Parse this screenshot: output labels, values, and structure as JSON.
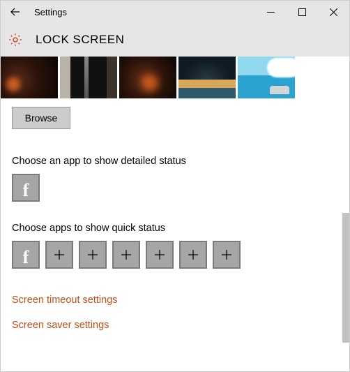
{
  "window": {
    "title": "Settings"
  },
  "page": {
    "title": "LOCK SCREEN"
  },
  "browse": {
    "label": "Browse"
  },
  "sections": {
    "detailed": "Choose an app to show detailed status",
    "quick": "Choose apps to show quick status"
  },
  "links": {
    "timeout": "Screen timeout settings",
    "saver": "Screen saver settings"
  },
  "icons": {
    "fb_letter": "f",
    "plus": "+"
  }
}
